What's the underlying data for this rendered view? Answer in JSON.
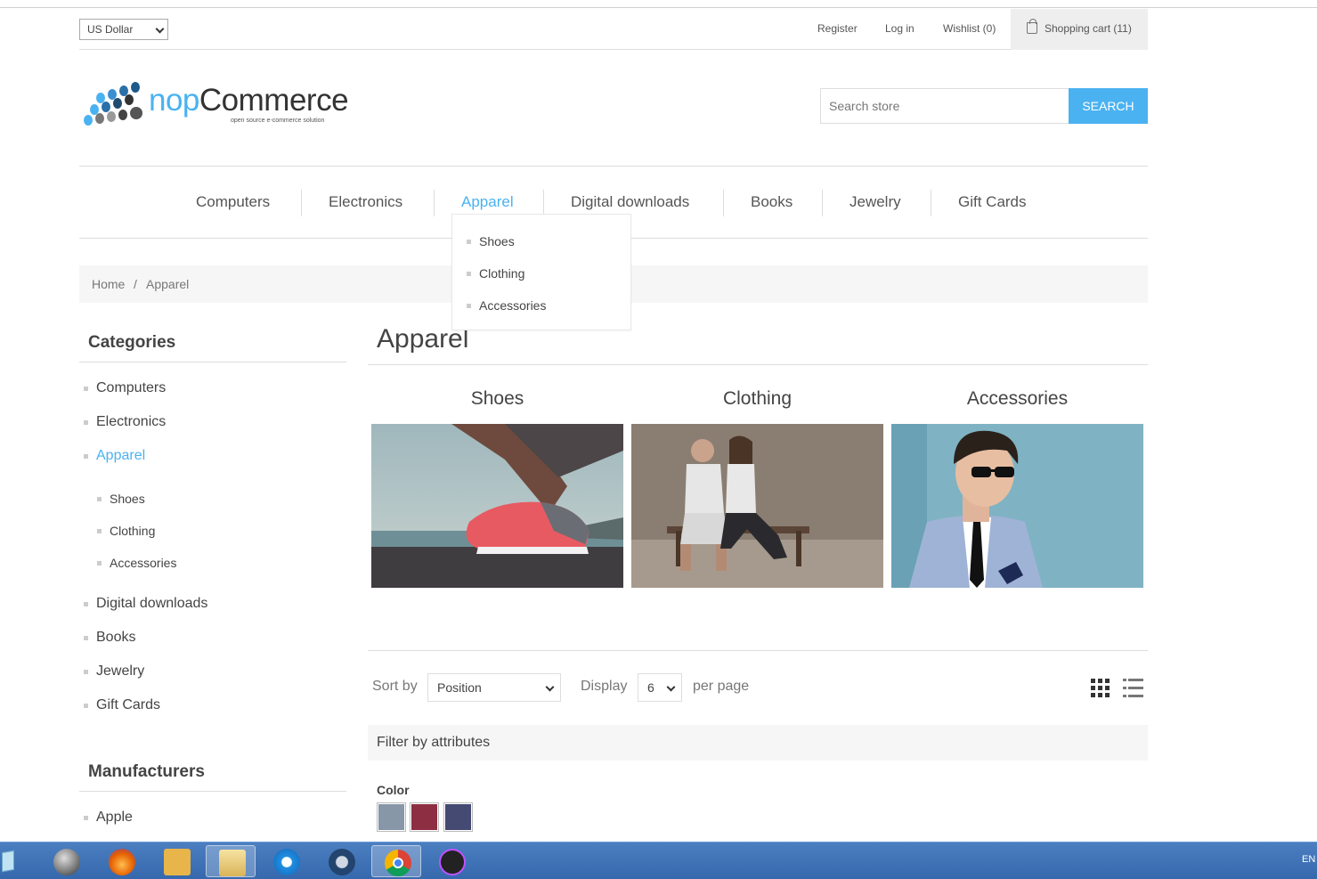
{
  "header": {
    "currency": "US Dollar",
    "register": "Register",
    "login": "Log in",
    "wishlist": "Wishlist (0)",
    "cart": "Shopping cart (11)"
  },
  "logo": {
    "brand_prefix": "nop",
    "brand_suffix": "Commerce",
    "tagline": "open source e-commerce solution"
  },
  "search": {
    "placeholder": "Search store",
    "button": "SEARCH"
  },
  "topnav": [
    {
      "label": "Computers"
    },
    {
      "label": "Electronics"
    },
    {
      "label": "Apparel",
      "active": true
    },
    {
      "label": "Digital downloads"
    },
    {
      "label": "Books"
    },
    {
      "label": "Jewelry"
    },
    {
      "label": "Gift Cards"
    }
  ],
  "dropdown": [
    "Shoes",
    "Clothing",
    "Accessories"
  ],
  "breadcrumb": {
    "home": "Home",
    "separator": "/",
    "current": "Apparel"
  },
  "sidebar": {
    "categories_title": "Categories",
    "categories": [
      "Computers",
      "Electronics",
      "Apparel",
      "Digital downloads",
      "Books",
      "Jewelry",
      "Gift Cards"
    ],
    "subcategories": [
      "Shoes",
      "Clothing",
      "Accessories"
    ],
    "manufacturers_title": "Manufacturers",
    "manufacturers": [
      "Apple"
    ]
  },
  "main": {
    "title": "Apparel",
    "subcategories": [
      {
        "title": "Shoes"
      },
      {
        "title": "Clothing"
      },
      {
        "title": "Accessories"
      }
    ],
    "sort_label": "Sort by",
    "sort_value": "Position",
    "display_label": "Display",
    "display_value": "6",
    "per_page": "per page",
    "filter_title": "Filter by attributes",
    "color_label": "Color",
    "colors": [
      "#8897a8",
      "#8e2e43",
      "#444a72"
    ]
  },
  "taskbar": {
    "lang": "EN"
  },
  "theme": {
    "accent": "#4ab2f1"
  }
}
